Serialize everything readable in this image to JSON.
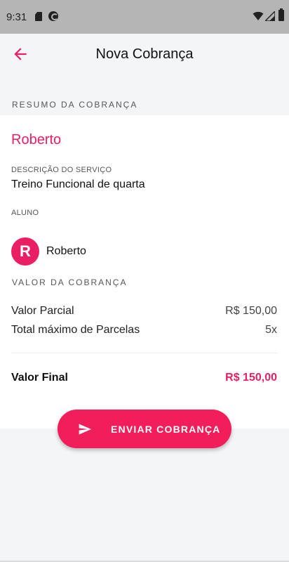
{
  "status_bar": {
    "time": "9:31",
    "icons": [
      "sd-card-icon",
      "sync-icon",
      "wifi-icon",
      "cell-signal-icon",
      "battery-icon"
    ]
  },
  "app_bar": {
    "title": "Nova Cobrança",
    "back_icon": "arrow-back-icon"
  },
  "summary": {
    "section_label": "RESUMO DA COBRANÇA",
    "client_name": "Roberto",
    "service_label": "DESCRIÇÃO DO SERVIÇO",
    "service_value": "Treino Funcional de quarta",
    "student_label": "ALUNO",
    "student_avatar_letter": "R",
    "student_name": "Roberto"
  },
  "charge_value": {
    "section_label": "VALOR DA COBRANÇA",
    "partial_label": "Valor Parcial",
    "partial_value": "R$ 150,00",
    "installments_label": "Total máximo de Parcelas",
    "installments_value": "5x",
    "final_label": "Valor Final",
    "final_value": "R$ 150,00"
  },
  "actions": {
    "send_label": "ENVIAR COBRANÇA",
    "send_icon": "send-icon"
  },
  "colors": {
    "accent": "#e91e63",
    "button": "#f21e5b",
    "status_bar": "#b5b5b5",
    "background": "#f4f5f7"
  }
}
